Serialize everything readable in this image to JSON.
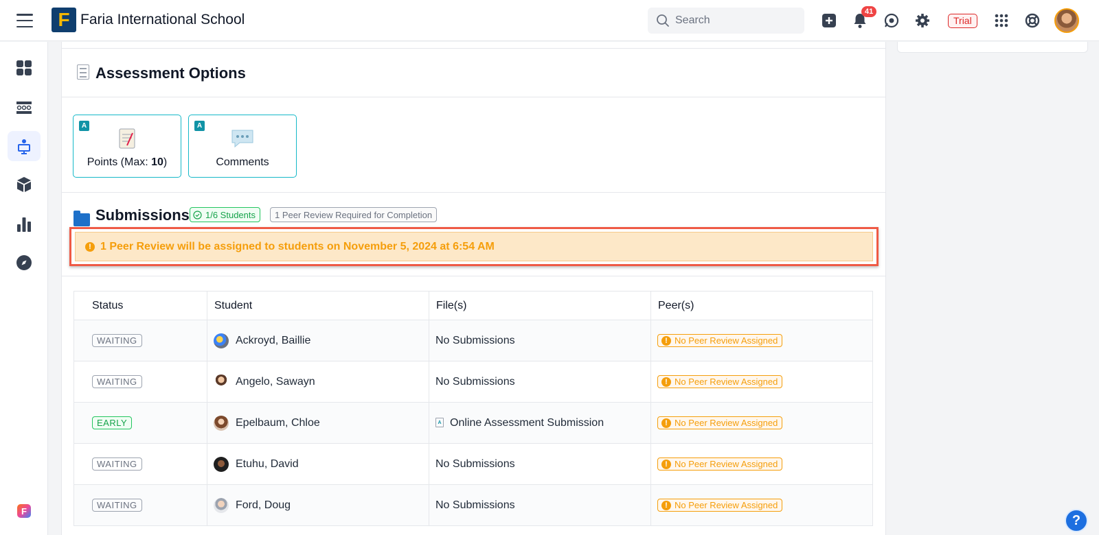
{
  "header": {
    "logo_letter": "F",
    "school_name": "Faria International School",
    "search_placeholder": "Search",
    "notification_count": "41",
    "trial_label": "Trial"
  },
  "assessment_options": {
    "title": "Assessment Options",
    "cards": [
      {
        "badge": "A",
        "label_prefix": "Points (Max: ",
        "label_value": "10",
        "label_suffix": ")"
      },
      {
        "badge": "A",
        "label": "Comments"
      }
    ]
  },
  "submissions": {
    "title": "Submissions",
    "students_pill": "1/6 Students",
    "peer_pill": "1 Peer Review Required for Completion",
    "alert_icon": "!",
    "alert_text": "1 Peer Review will be assigned to students on November 5, 2024 at 6:54 AM"
  },
  "table": {
    "headers": [
      "Status",
      "Student",
      "File(s)",
      "Peer(s)"
    ],
    "rows": [
      {
        "status": "WAITING",
        "student": "Ackroyd, Baillie",
        "files": "No Submissions",
        "peers": "No Peer Review Assigned"
      },
      {
        "status": "WAITING",
        "student": "Angelo, Sawayn",
        "files": "No Submissions",
        "peers": "No Peer Review Assigned"
      },
      {
        "status": "EARLY",
        "student": "Epelbaum, Chloe",
        "files": "Online Assessment Submission",
        "peers": "No Peer Review Assigned"
      },
      {
        "status": "WAITING",
        "student": "Etuhu, David",
        "files": "No Submissions",
        "peers": "No Peer Review Assigned"
      },
      {
        "status": "WAITING",
        "student": "Ford, Doug",
        "files": "No Submissions",
        "peers": "No Peer Review Assigned"
      }
    ]
  },
  "help_label": "?",
  "bottom_logo_letter": "F",
  "colors": {
    "accent": "#14b8c8",
    "warning": "#f59e0b",
    "success": "#16a34a",
    "highlight_border": "#ef5a45"
  }
}
